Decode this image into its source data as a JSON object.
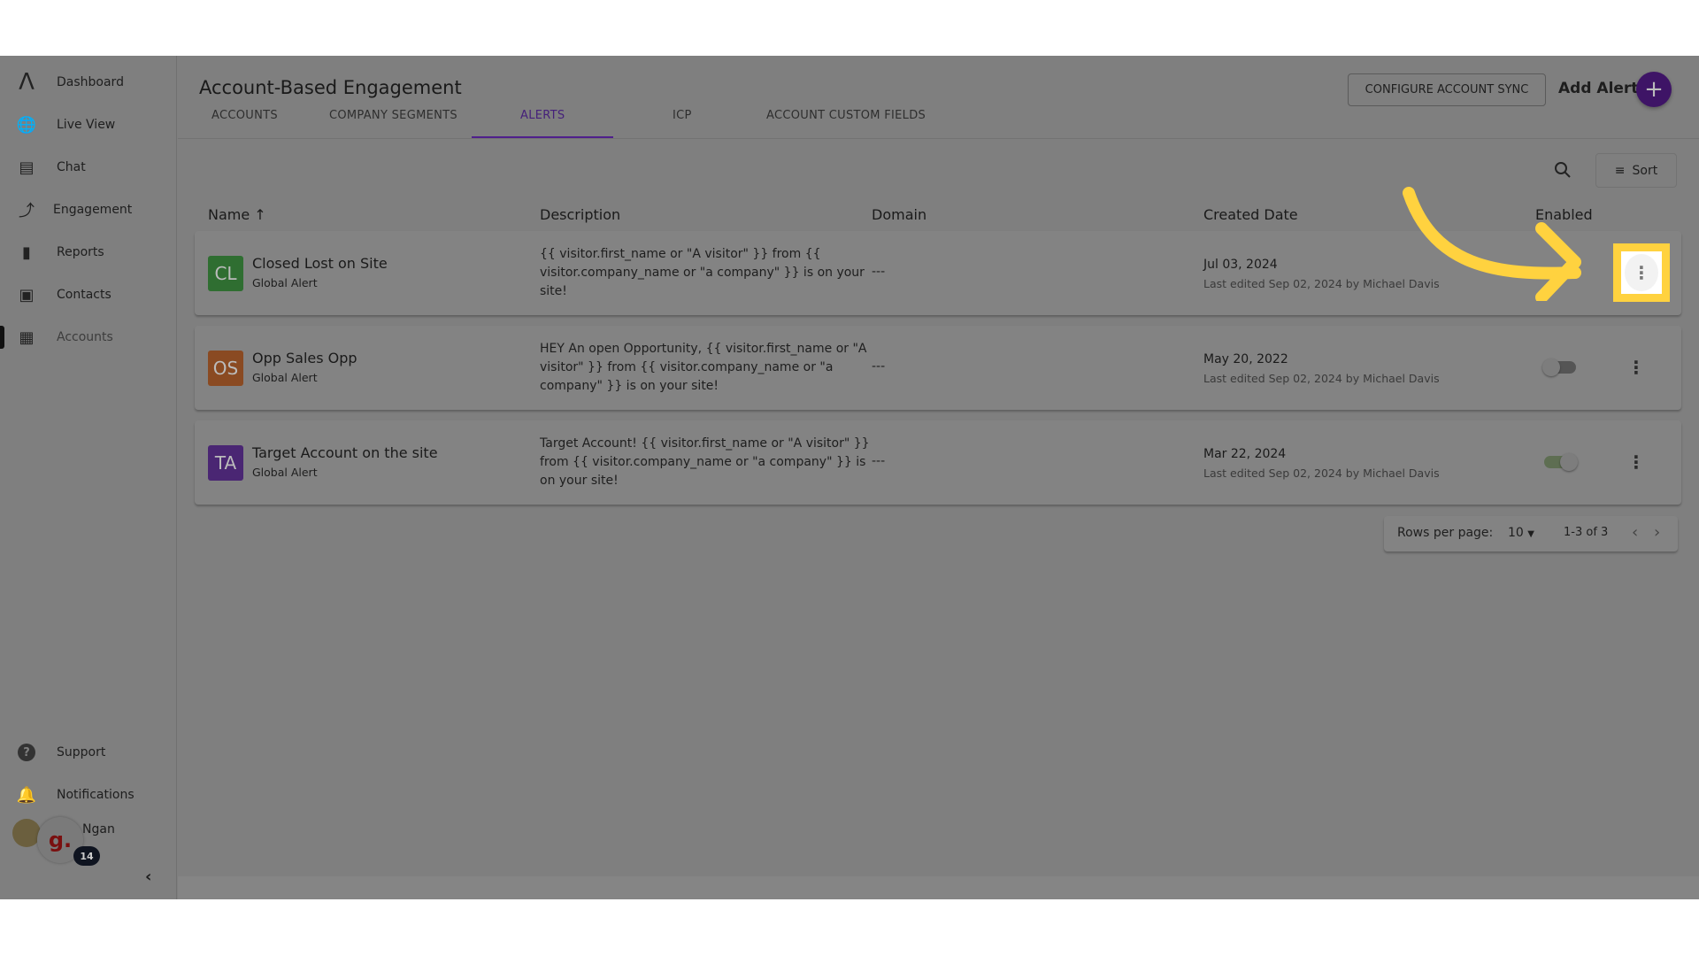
{
  "sidebar": {
    "items": [
      {
        "label": "Dashboard",
        "icon": "logo-icon"
      },
      {
        "label": "Live View",
        "icon": "globe-search-icon"
      },
      {
        "label": "Chat",
        "icon": "chat-icon"
      },
      {
        "label": "Engagement",
        "icon": "engagement-icon"
      },
      {
        "label": "Reports",
        "icon": "bar-chart-icon"
      },
      {
        "label": "Contacts",
        "icon": "contacts-icon"
      },
      {
        "label": "Accounts",
        "icon": "building-icon",
        "active": true
      }
    ],
    "support": "Support",
    "notifications": "Notifications",
    "user": {
      "name": "Ngan",
      "badge": "14",
      "org_logo": "g."
    }
  },
  "header": {
    "title": "Account-Based Engagement",
    "tabs": [
      "ACCOUNTS",
      "COMPANY SEGMENTS",
      "ALERTS",
      "ICP",
      "ACCOUNT CUSTOM FIELDS"
    ],
    "active_tab": "ALERTS",
    "configure_button": "CONFIGURE ACCOUNT SYNC",
    "add_alert": "Add Alert",
    "add_icon": "+"
  },
  "toolbar": {
    "sort": "Sort"
  },
  "table": {
    "columns": [
      "Name",
      "Description",
      "Domain",
      "Created Date",
      "Enabled"
    ],
    "rows": [
      {
        "initials": "CL",
        "color": "#2f6e31",
        "name": "Closed Lost on Site",
        "type": "Global Alert",
        "description": "{{ visitor.first_name or \"A visitor\" }} from {{ visitor.company_name or \"a company\" }} is on your site!",
        "domain": "---",
        "created": "Jul 03, 2024",
        "edited": "Last edited Sep 02, 2024 by Michael Davis",
        "enabled": false
      },
      {
        "initials": "OS",
        "color": "#8a4a22",
        "name": "Opp Sales Opp",
        "type": "Global Alert",
        "description": "HEY An open Opportunity, {{ visitor.first_name or \"A visitor\" }} from {{ visitor.company_name or \"a company\" }} is on your site!",
        "domain": "---",
        "created": "May 20, 2022",
        "edited": "Last edited Sep 02, 2024 by Michael Davis",
        "enabled": false
      },
      {
        "initials": "TA",
        "color": "#4a2673",
        "name": "Target Account on the site",
        "type": "Global Alert",
        "description": "Target Account! {{ visitor.first_name or \"A visitor\" }} from {{ visitor.company_name or \"a company\" }} is on your site!",
        "domain": "---",
        "created": "Mar 22, 2024",
        "edited": "Last edited Sep 02, 2024 by Michael Davis",
        "enabled": true
      }
    ]
  },
  "pagination": {
    "rows_label": "Rows per page:",
    "rows_value": "10",
    "range": "1-3 of 3"
  },
  "colors": {
    "accent": "#6a2bc2",
    "highlight": "#ffd23f",
    "toggle_on": "#5e6e52"
  }
}
